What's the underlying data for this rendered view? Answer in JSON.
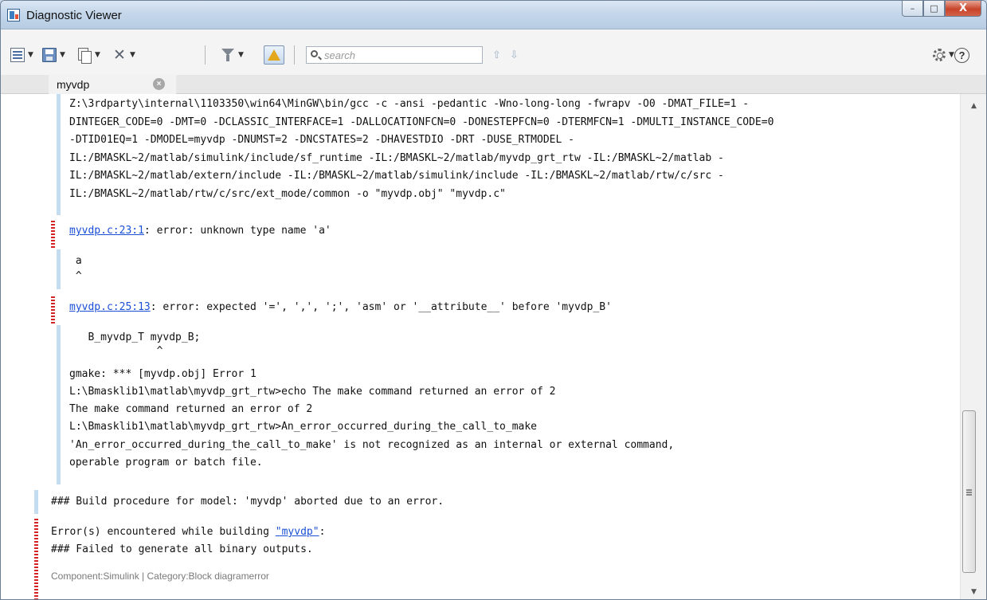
{
  "window": {
    "title": "Diagnostic Viewer"
  },
  "window_buttons": {
    "minimize": "–",
    "maximize": "□",
    "close": "X"
  },
  "toolbar": {
    "icons": [
      "list-view-icon",
      "save-icon",
      "copy-icon",
      "clear-icon",
      "filter-icon",
      "warning-icon"
    ],
    "search_placeholder": "search",
    "prev_arrow": "⇧",
    "next_arrow": "⇩",
    "dropdown_arrow": "▼",
    "help_label": "?"
  },
  "tabs": [
    {
      "label": "myvdp",
      "close": "×"
    }
  ],
  "log": {
    "cmd_lines": [
      "Z:\\3rdparty\\internal\\1103350\\win64\\MinGW\\bin/gcc -c -ansi -pedantic -Wno-long-long -fwrapv -O0 -DMAT_FILE=1 -",
      "DINTEGER_CODE=0 -DMT=0 -DCLASSIC_INTERFACE=1 -DALLOCATIONFCN=0 -DONESTEPFCN=0 -DTERMFCN=1 -DMULTI_INSTANCE_CODE=0",
      "-DTID01EQ=1 -DMODEL=myvdp -DNUMST=2 -DNCSTATES=2 -DHAVESTDIO -DRT -DUSE_RTMODEL -",
      "IL:/BMASKL~2/matlab/simulink/include/sf_runtime -IL:/BMASKL~2/matlab/myvdp_grt_rtw -IL:/BMASKL~2/matlab -",
      "IL:/BMASKL~2/matlab/extern/include -IL:/BMASKL~2/matlab/simulink/include -IL:/BMASKL~2/matlab/rtw/c/src -",
      "IL:/BMASKL~2/matlab/rtw/c/src/ext_mode/common -o \"myvdp.obj\" \"myvdp.c\""
    ],
    "error1": {
      "link": "myvdp.c:23:1",
      "text": ": error: unknown type name 'a'"
    },
    "error1_snippet": [
      " a",
      " ^"
    ],
    "error2": {
      "link": "myvdp.c:25:13",
      "text": ": error: expected '=', ',', ';', 'asm' or '__attribute__' before 'myvdp_B'"
    },
    "error2_snippet": [
      "   B_myvdp_T myvdp_B;",
      "              ^"
    ],
    "make_lines": [
      "gmake: *** [myvdp.obj] Error 1",
      "L:\\Bmasklib1\\matlab\\myvdp_grt_rtw>echo The make command returned an error of 2",
      "The make command returned an error of 2",
      "L:\\Bmasklib1\\matlab\\myvdp_grt_rtw>An_error_occurred_during_the_call_to_make",
      "'An_error_occurred_during_the_call_to_make' is not recognized as an internal or external command,",
      "operable program or batch file."
    ],
    "build_aborted": "### Build procedure for model: 'myvdp' aborted due to an error.",
    "summary": {
      "prefix": "Error(s) encountered while building ",
      "link": "\"myvdp\"",
      "suffix": ":",
      "line2": "### Failed to generate all binary outputs."
    },
    "footer": "Component:Simulink | Category:Block diagramerror"
  },
  "scrollbar": {
    "up": "▲",
    "down": "▼"
  },
  "colors": {
    "error_marker": "#d32525",
    "info_marker": "#c3dcef",
    "link": "#1a4fd6"
  }
}
